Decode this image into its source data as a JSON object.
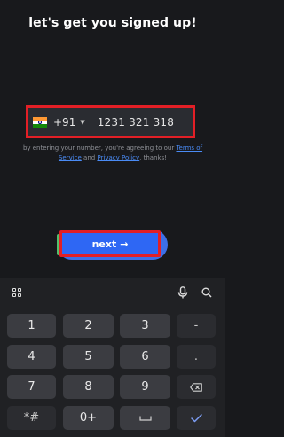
{
  "header": {
    "title": "let's get you signed up!"
  },
  "phone": {
    "country_flag": "india-flag-icon",
    "country_code": "+91",
    "number": "1231 321 318"
  },
  "terms": {
    "prefix": "by entering your number, you're agreeing to our ",
    "terms_link": "Terms of Service",
    "middle": " and ",
    "privacy_link": "Privacy Policy",
    "suffix": ", thanks!"
  },
  "next_button": {
    "label": "next",
    "arrow": "→"
  },
  "keyboard": {
    "toolbar_icons": [
      "grid-icon",
      "mic-icon",
      "search-icon"
    ],
    "keys": {
      "k1": "1",
      "k2": "2",
      "k3": "3",
      "dash": "-",
      "k4": "4",
      "k5": "5",
      "k6": "6",
      "dot": ".",
      "k7": "7",
      "k8": "8",
      "k9": "9",
      "star_hash": "*#",
      "k0": "0+"
    }
  },
  "colors": {
    "background": "#18191c",
    "accent_blue": "#2e67f4",
    "link_blue": "#4a8bf5",
    "highlight_red": "#e21f26"
  }
}
